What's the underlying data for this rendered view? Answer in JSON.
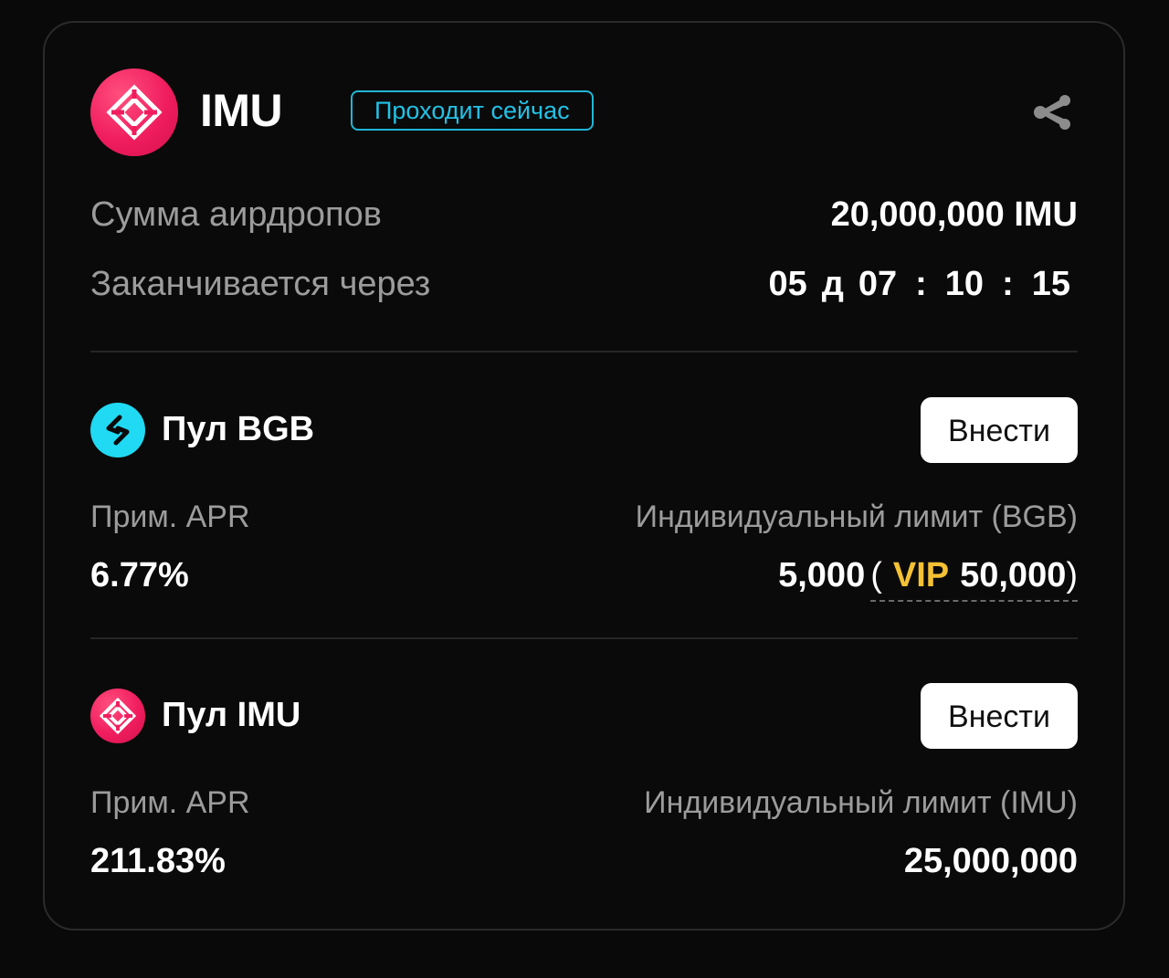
{
  "header": {
    "token_name": "IMU",
    "status_badge": "Проходит сейчас",
    "token_icon": "imu-logo-icon",
    "share_icon": "share-icon"
  },
  "summary": {
    "airdrop_label": "Сумма аирдропов",
    "airdrop_value": "20,000,000 IMU",
    "ends_label": "Заканчивается через",
    "countdown": {
      "days": "05",
      "days_unit": "д",
      "hours": "07",
      "minutes": "10",
      "seconds": "15",
      "separator": ":"
    }
  },
  "pools": [
    {
      "title": "Пул BGB",
      "icon": "bgb-logo-icon",
      "deposit_label": "Внести",
      "apr_label": "Прим. APR",
      "apr_value": "6.77%",
      "limit_label": "Индивидуальный лимит (BGB)",
      "limit_value": "5,000",
      "vip_open": "(",
      "vip_label": "VIP",
      "vip_value": "50,000",
      "vip_close": ")"
    },
    {
      "title": "Пул IMU",
      "icon": "imu-logo-icon",
      "deposit_label": "Внести",
      "apr_label": "Прим. APR",
      "apr_value": "211.83%",
      "limit_label": "Индивидуальный лимит (IMU)",
      "limit_value": "25,000,000"
    }
  ],
  "colors": {
    "background": "#090909",
    "badge": "#22c2e6",
    "vip": "#f4c134",
    "imu_brand": "#f01d5e",
    "bgb_brand": "#20d9f2"
  }
}
